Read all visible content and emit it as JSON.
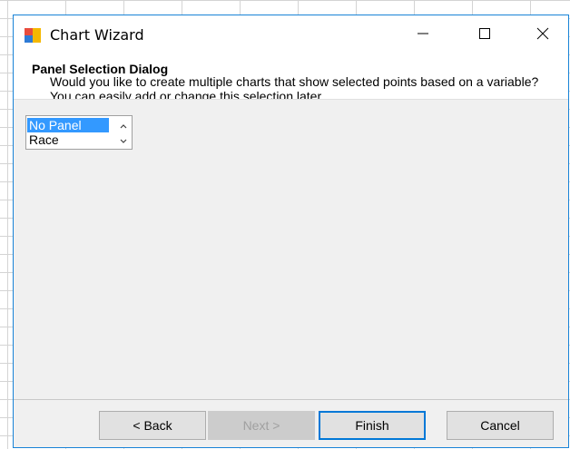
{
  "window": {
    "title": "Chart Wizard",
    "icon": "chart-wizard-app-icon",
    "controls": {
      "minimize": "minimize-icon",
      "maximize": "maximize-icon",
      "close": "close-icon"
    }
  },
  "header": {
    "heading": "Panel Selection Dialog",
    "description": "Would you like to create multiple charts that show selected points based on a variable?  You can easily add or change this selection later."
  },
  "panel_list": {
    "items": [
      {
        "label": "No Panel",
        "selected": true
      },
      {
        "label": "Race",
        "selected": false
      }
    ],
    "scroll_up_icon": "chevron-up-icon",
    "scroll_down_icon": "chevron-down-icon"
  },
  "buttons": {
    "back": "< Back",
    "next": "Next >",
    "finish": "Finish",
    "cancel": "Cancel"
  },
  "colors": {
    "accent": "#1883d7",
    "selection": "#3399ff",
    "dialog_bg": "#f0f0f0"
  }
}
